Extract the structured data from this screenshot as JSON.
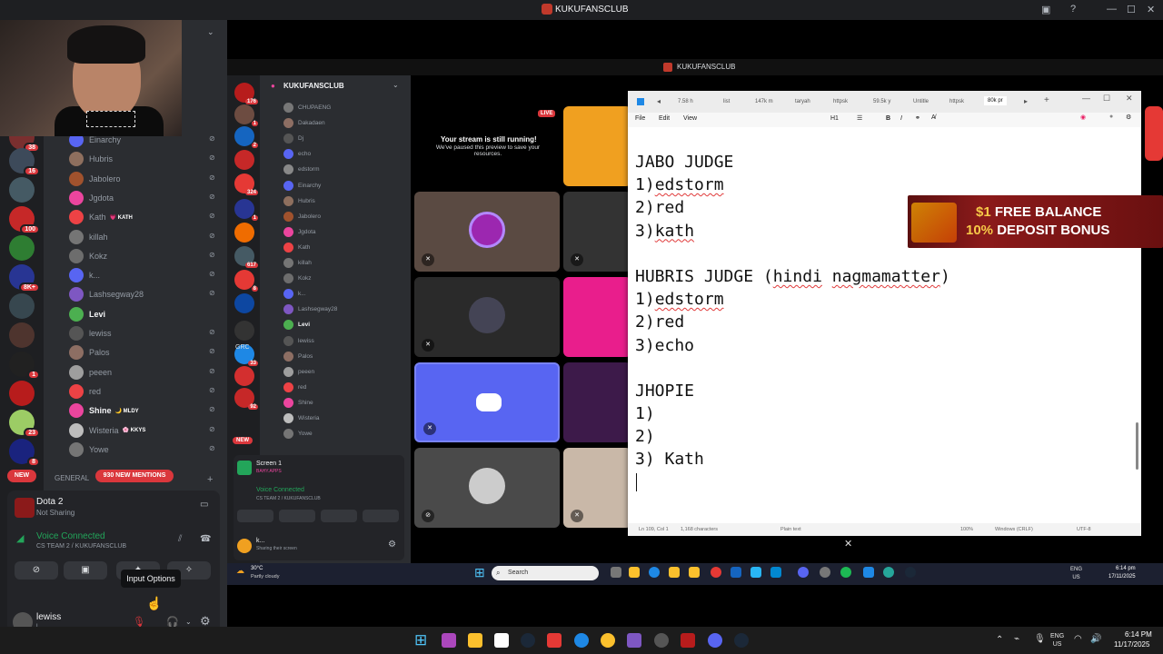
{
  "window": {
    "title": "KUKUFANSCLUB"
  },
  "stream": {
    "title": "KUKUFANSCLUB",
    "live": "LIVE",
    "paused_title": "Your stream is still running!",
    "paused_text": "We've paused this preview to save your resources."
  },
  "left": {
    "members": [
      {
        "name": "Einarchy",
        "color": "#5865f2"
      },
      {
        "name": "Hubris",
        "color": "#8e6f5e"
      },
      {
        "name": "Jabolero",
        "color": "#a0522d"
      },
      {
        "name": "Jgdota",
        "color": "#eb459e"
      },
      {
        "name": "Kath",
        "color": "#ed4245",
        "tag": "💗 KATH"
      },
      {
        "name": "killah",
        "color": "#757575"
      },
      {
        "name": "Kokz",
        "color": "#6d6d6d"
      },
      {
        "name": "k...",
        "color": "#5865f2"
      },
      {
        "name": "Lashsegway28",
        "color": "#7e57c2"
      },
      {
        "name": "Levi",
        "color": "#4caf50",
        "bold": true
      },
      {
        "name": "lewiss",
        "color": "#555"
      },
      {
        "name": "Palos",
        "color": "#8d6e63"
      },
      {
        "name": "peeen",
        "color": "#9e9e9e"
      },
      {
        "name": "red",
        "color": "#ed4245"
      },
      {
        "name": "Shine",
        "color": "#eb459e",
        "tag": "🌙 MLDY",
        "bold": true
      },
      {
        "name": "Wisteria",
        "color": "#bdbdbd",
        "tag": "🌸 KKYS"
      },
      {
        "name": "Yowe",
        "color": "#757575"
      }
    ],
    "new_pill": "NEW",
    "mentions": "930 NEW MENTIONS",
    "general": "GENERAL",
    "activity": {
      "game": "Dota 2",
      "status": "Not Sharing"
    },
    "voice": {
      "title": "Voice Connected",
      "channel": "CS TEAM 2 / KUKUFANSCLUB"
    },
    "tooltip": "Input Options",
    "user": {
      "name": "lewiss",
      "sub": "l..."
    },
    "guild_badges": [
      "38",
      "16",
      "100",
      "8K+",
      "1",
      "23",
      "8"
    ]
  },
  "mid": {
    "server": "KUKUFANSCLUB",
    "members": [
      "CHUPAENG",
      "Dakadaen",
      "Dj",
      "echo",
      "edstorm",
      "Einarchy",
      "Hubris",
      "Jabolero",
      "Jgdota",
      "Kath",
      "killah",
      "Kokz",
      "k...",
      "Lashsegway28",
      "Levi",
      "lewiss",
      "Palos",
      "peeen",
      "red",
      "Shine",
      "Wisteria",
      "Yowe"
    ],
    "guild_badges": [
      "176",
      "1",
      "2",
      "324",
      "1",
      "617",
      "8",
      "33",
      "92"
    ],
    "screen": "Screen 1",
    "screen_sub": "BAHY.APPS",
    "voice": "Voice Connected",
    "voice_channel": "CS TEAM 2 / KUKUFANSCLUB",
    "user": "k...",
    "user_sub": "Sharing their screen",
    "new": "NEW",
    "grc": "GRC"
  },
  "notepad": {
    "tabs": [
      "7.58 h",
      "list",
      "147k m",
      "taryah",
      "httpsk",
      "59.5k y",
      "Untitle",
      "httpsk",
      "80k pr"
    ],
    "menu": [
      "File",
      "Edit",
      "View"
    ],
    "heading": "H1",
    "lines": [
      {
        "text": "JABO JUDGE"
      },
      {
        "pre": "1)",
        "sq": "edstorm"
      },
      {
        "text": "2)red"
      },
      {
        "pre": "3)",
        "sq": "kath"
      },
      {
        "text": ""
      },
      {
        "pre": "HUBRIS JUDGE (",
        "sq": "hindi",
        "mid": " ",
        "sq2": "nagmamatter",
        "post": ")"
      },
      {
        "pre": "1)",
        "sq": "edstorm"
      },
      {
        "text": "2)red"
      },
      {
        "text": "3)echo"
      },
      {
        "text": ""
      },
      {
        "text": "JHOPIE"
      },
      {
        "text": "1)"
      },
      {
        "text": "2)"
      },
      {
        "text": "3) Kath"
      }
    ],
    "status": {
      "pos": "Ln 109, Col 1",
      "chars": "1,168 characters",
      "format": "Plain text",
      "zoom": "100%",
      "eol": "Windows (CRLF)",
      "enc": "UTF-8"
    }
  },
  "ad": {
    "line1_a": "$1",
    "line1_b": " FREE BALANCE",
    "line2_a": "10%",
    "line2_b": " DEPOSIT BONUS"
  },
  "taskbar_inner": {
    "weather_temp": "30°C",
    "weather_desc": "Partly cloudy",
    "search": "Search",
    "lang": "ENG\nUS",
    "time": "6:14 pm",
    "date": "17/11/2025"
  },
  "taskbar": {
    "lang": "ENG\nUS",
    "time": "6:14 PM",
    "date": "11/17/2025"
  },
  "colors": {
    "discord_bg": "#2b2d31",
    "accent": "#5865f2",
    "voice_green": "#23a55a",
    "danger": "#da373c"
  }
}
